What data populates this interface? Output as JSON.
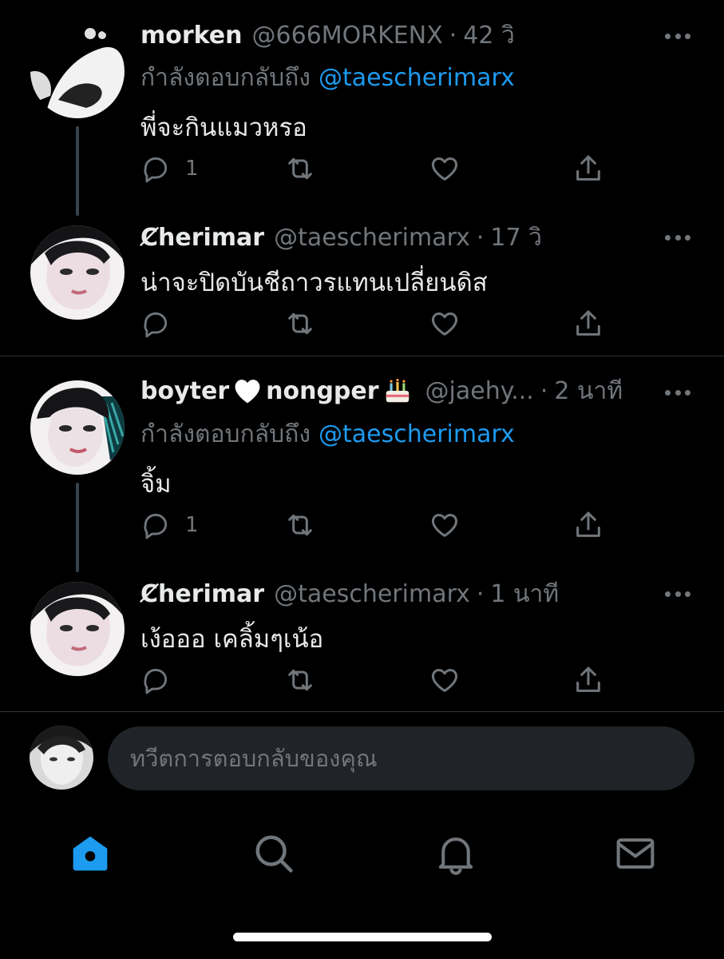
{
  "tweets": [
    {
      "name": "morken",
      "handle": "@666MORKENX",
      "separator": "·",
      "time": "42 วิ",
      "reply_label": "กำลังตอบกลับถึง",
      "reply_mention": "@taescherimarx",
      "text": "พี่จะกินแมวหรอ",
      "reply_count": "1"
    },
    {
      "name": "Ȼherimar",
      "handle": "@taescherimarx",
      "separator": "·",
      "time": "17 วิ",
      "text": "น่าจะปิดบันชีถาวรแทนเปลี่ยนดิส"
    },
    {
      "name_part1": "boyter",
      "name_part2": "nongper",
      "handle": "@jaehy...",
      "separator": "·",
      "time": "2 นาที",
      "reply_label": "กำลังตอบกลับถึง",
      "reply_mention": "@taescherimarx",
      "text": "จิ้ม",
      "reply_count": "1"
    },
    {
      "name": "Ȼherimar",
      "handle": "@taescherimarx",
      "separator": "·",
      "time": "1 นาที",
      "text": "เง้อออ เคลิ้มๆเน้อ"
    }
  ],
  "composer": {
    "placeholder": "ทวีตการตอบกลับของคุณ"
  },
  "nav": {
    "items": [
      "home-icon",
      "search-icon",
      "bell-icon",
      "mail-icon"
    ],
    "active": "home-icon"
  },
  "colors": {
    "background": "#000000",
    "accent": "#1d9bf0",
    "secondary_text": "#71767b",
    "primary_text": "#e7e9ea"
  }
}
